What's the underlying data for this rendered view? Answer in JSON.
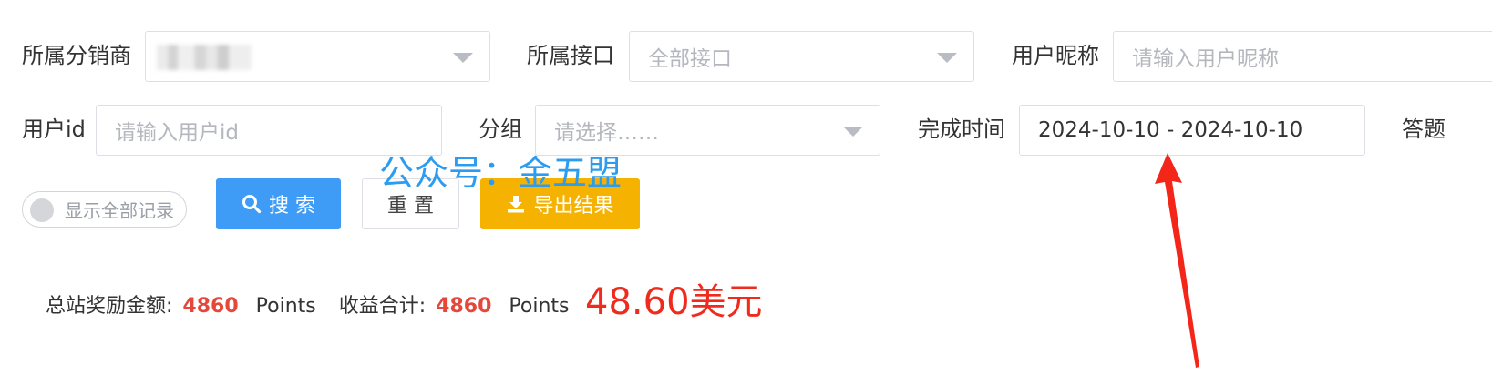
{
  "filters": {
    "distributor": {
      "label": "所属分销商",
      "value": ""
    },
    "interface": {
      "label": "所属接口",
      "value": "全部接口"
    },
    "nickname": {
      "label": "用户昵称",
      "placeholder": "请输入用户昵称"
    },
    "user_id": {
      "label": "用户id",
      "placeholder": "请输入用户id"
    },
    "group": {
      "label": "分组",
      "placeholder": "请选择……"
    },
    "finish_time": {
      "label": "完成时间",
      "value": "2024-10-10 - 2024-10-10"
    },
    "truncated_label": "答题"
  },
  "toolbar": {
    "show_all_label": "显示全部记录",
    "search_label": "搜 索",
    "reset_label": "重 置",
    "export_label": "导出结果"
  },
  "watermark": "公众号：金五盟",
  "summary": {
    "total_reward_label": "总站奖励金额:",
    "total_reward_value": "4860",
    "total_reward_unit": "Points",
    "income_label": "收益合计:",
    "income_value": "4860",
    "income_unit": "Points",
    "usd_amount": "48.60美元"
  },
  "colors": {
    "primary": "#3e9cf6",
    "warning": "#f6b200",
    "highlight_red": "#ef2b1e",
    "watermark_blue": "#2c9cf0"
  }
}
